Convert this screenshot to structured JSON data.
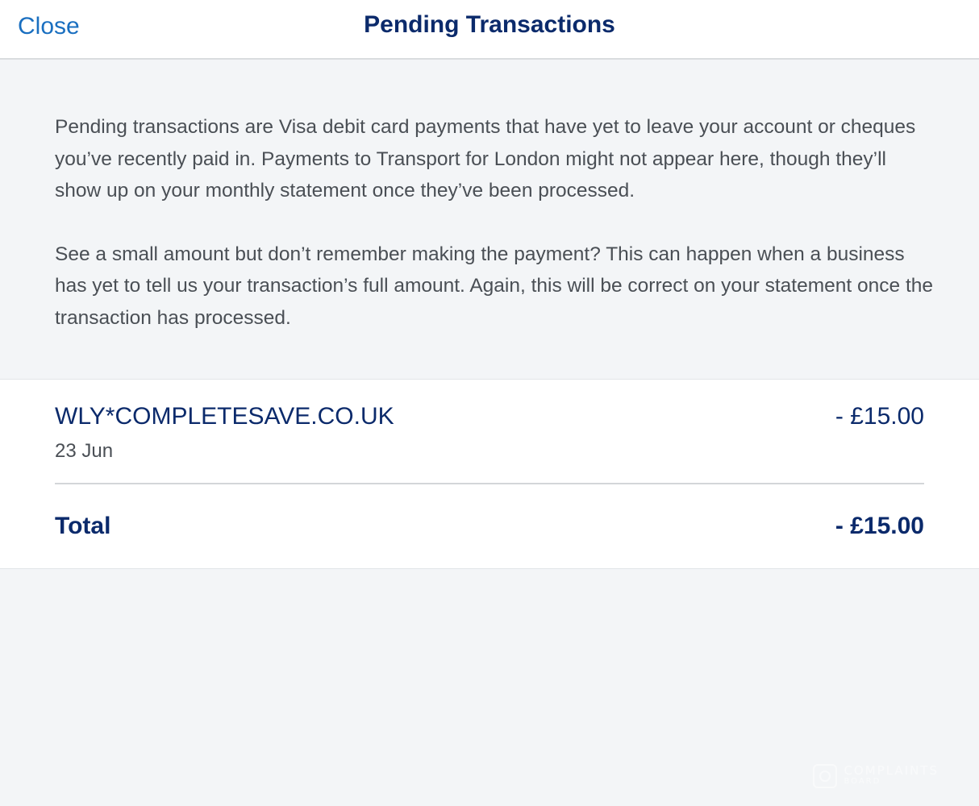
{
  "header": {
    "close_label": "Close",
    "title": "Pending Transactions"
  },
  "info": {
    "paragraphs": [
      "Pending transactions are Visa debit card payments that have yet to leave your account or cheques you’ve recently paid in. Payments to Transport for London might not appear here, though they’ll show up on your monthly statement once they’ve been processed.",
      "See a small amount but don’t remember making the payment? This can happen when a business has yet to tell us your transaction’s full amount. Again, this will be correct on your statement once the transaction has processed."
    ]
  },
  "transactions": [
    {
      "merchant": "WLY*COMPLETESAVE.CO.UK",
      "date": "23 Jun",
      "amount": "- £15.00"
    }
  ],
  "total": {
    "label": "Total",
    "amount": "- £15.00"
  },
  "watermark": {
    "line1": "COMPLAINTS",
    "line2": "BOARD"
  },
  "colors": {
    "link": "#1a6fc0",
    "brand_navy": "#0b2a6b",
    "body_text": "#4a4f55",
    "background": "#f3f5f7"
  }
}
